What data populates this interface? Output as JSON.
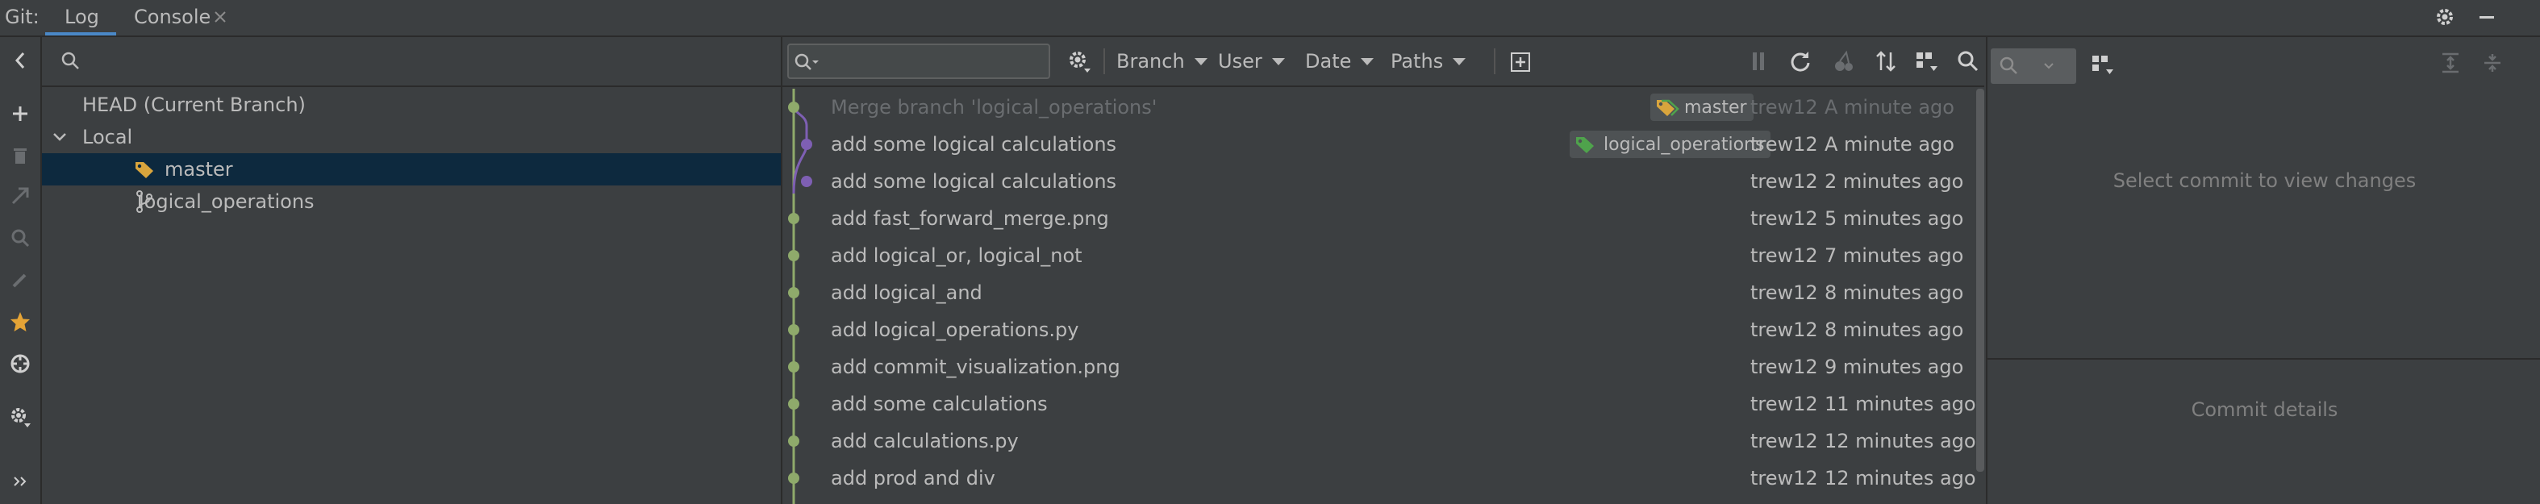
{
  "tool_window": {
    "title": "Git:",
    "tabs": [
      {
        "label": "Log",
        "active": true
      },
      {
        "label": "Console",
        "active": false
      }
    ]
  },
  "branches": {
    "search_placeholder": "",
    "items": [
      {
        "label": "HEAD (Current Branch)",
        "level": 0
      },
      {
        "label": "Local",
        "level": 0,
        "expanded": true
      },
      {
        "label": "master",
        "level": 1,
        "selected": true,
        "icon": "tag-icon"
      },
      {
        "label": "logical_operations",
        "level": 1,
        "icon": "branch-icon"
      }
    ]
  },
  "log": {
    "search_value": "",
    "filters": [
      {
        "label": "Branch"
      },
      {
        "label": "User"
      },
      {
        "label": "Date"
      },
      {
        "label": "Paths"
      }
    ],
    "commits": [
      {
        "message": "Merge branch 'logical_operations'",
        "author": "trew12",
        "date": "A minute ago",
        "tag": "master",
        "dimmed": true
      },
      {
        "message": "add some logical calculations",
        "author": "trew12",
        "date": "A minute ago",
        "tag": "logical_operations",
        "dimmed": false
      },
      {
        "message": "add some logical calculations",
        "author": "trew12",
        "date": "2 minutes ago",
        "dimmed": false
      },
      {
        "message": "add fast_forward_merge.png",
        "author": "trew12",
        "date": "5 minutes ago",
        "dimmed": false
      },
      {
        "message": "add logical_or, logical_not",
        "author": "trew12",
        "date": "7 minutes ago",
        "dimmed": false
      },
      {
        "message": "add logical_and",
        "author": "trew12",
        "date": "8 minutes ago",
        "dimmed": false
      },
      {
        "message": "add logical_operations.py",
        "author": "trew12",
        "date": "8 minutes ago",
        "dimmed": false
      },
      {
        "message": "add commit_visualization.png",
        "author": "trew12",
        "date": "9 minutes ago",
        "dimmed": false
      },
      {
        "message": "add some calculations",
        "author": "trew12",
        "date": "11 minutes ago",
        "dimmed": false
      },
      {
        "message": "add calculations.py",
        "author": "trew12",
        "date": "12 minutes ago",
        "dimmed": false
      },
      {
        "message": "add prod and div",
        "author": "trew12",
        "date": "12 minutes ago",
        "dimmed": false
      }
    ]
  },
  "details": {
    "changes_placeholder": "Select commit to view changes",
    "details_placeholder": "Commit details"
  },
  "colors": {
    "background": "#3c3f41",
    "selection": "#0d293e",
    "accent": "#4a88c7",
    "graph_main": "#8faa6b",
    "graph_branch": "#7e5fb3"
  }
}
